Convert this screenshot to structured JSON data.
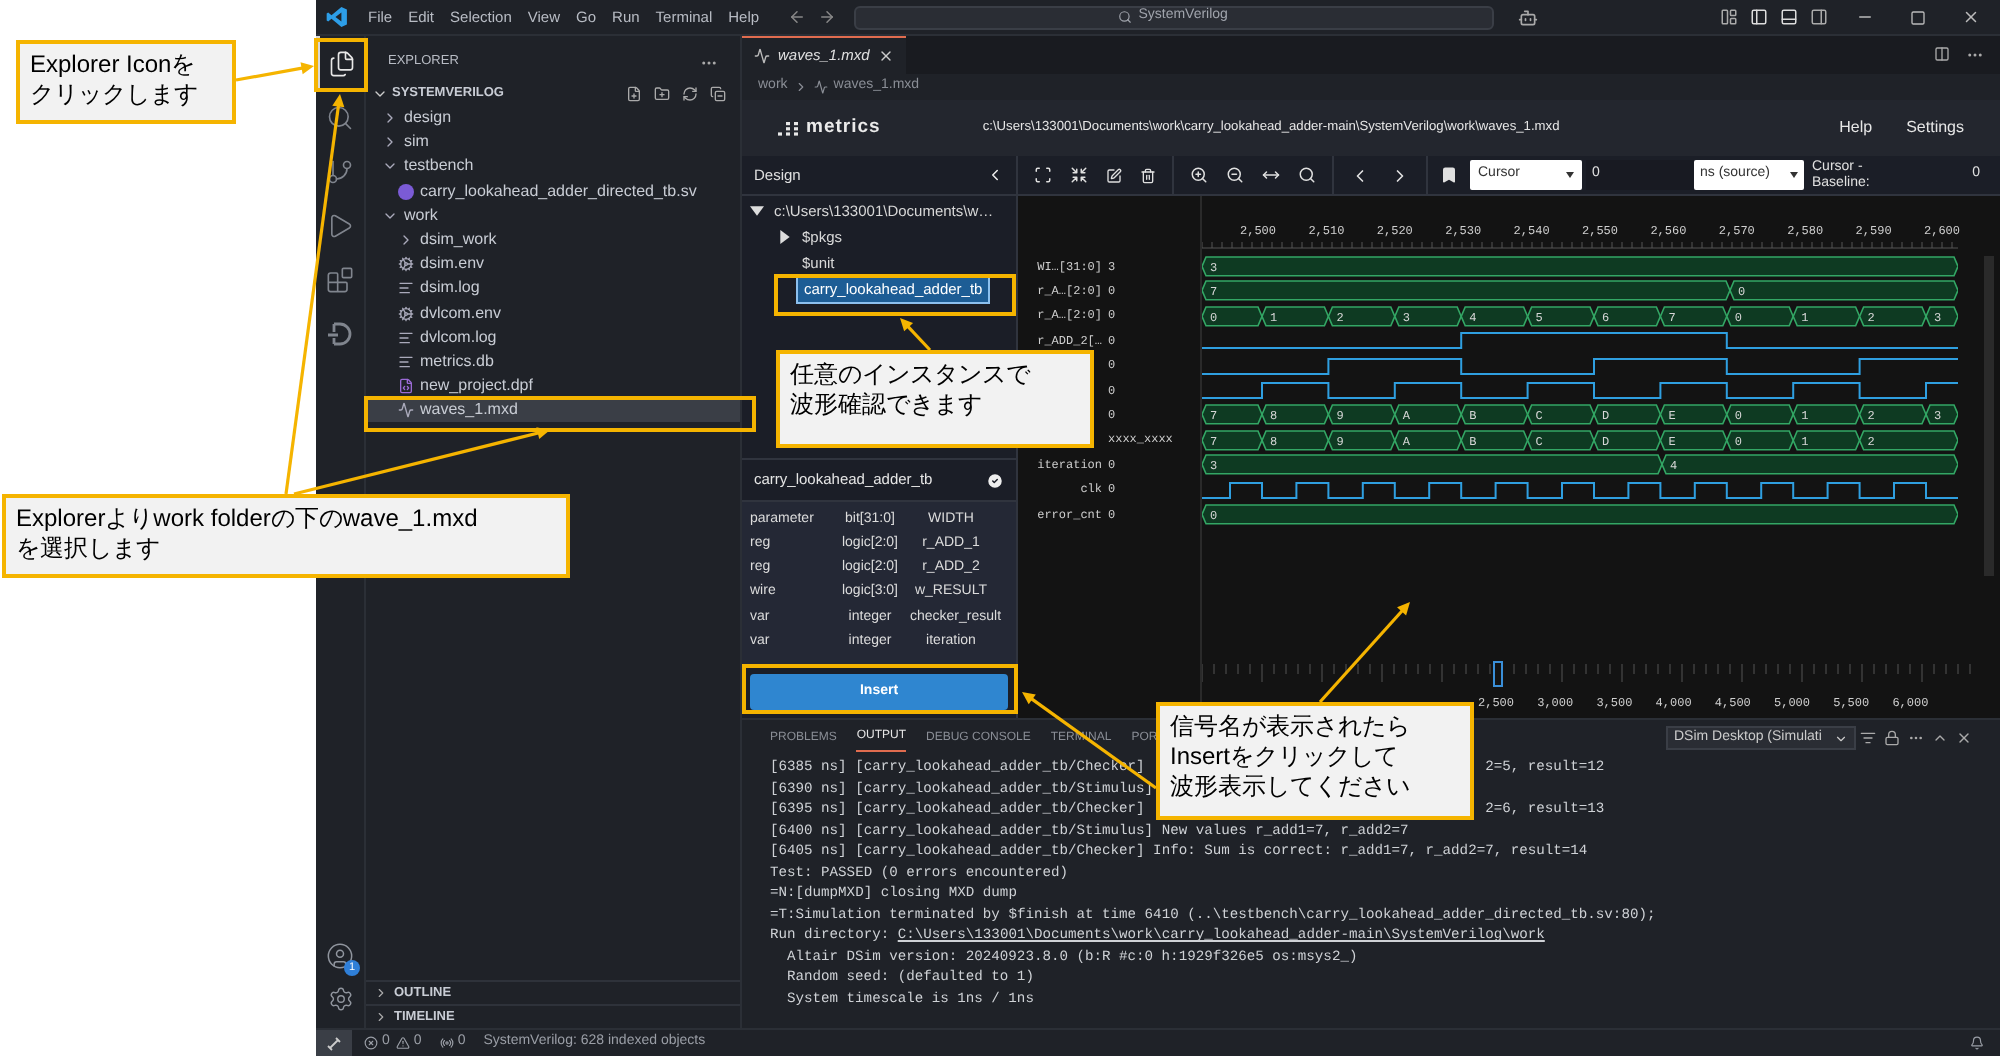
{
  "title_bar": {
    "menu": [
      "File",
      "Edit",
      "Selection",
      "View",
      "Go",
      "Run",
      "Terminal",
      "Help"
    ],
    "search": "SystemVerilog"
  },
  "activity_bar": {
    "items": [
      {
        "kind": "explorer",
        "selected": true
      },
      {
        "kind": "search",
        "selected": false
      },
      {
        "kind": "source-control",
        "selected": false
      },
      {
        "kind": "run",
        "selected": false
      },
      {
        "kind": "extensions",
        "selected": false
      },
      {
        "kind": "dsim",
        "selected": false
      }
    ],
    "account_badge": "1"
  },
  "sidebar": {
    "title": "EXPLORER",
    "section": "SYSTEMVERILOG",
    "tree": [
      {
        "label": "design",
        "kind": "folder",
        "expanded": false,
        "selected": false
      },
      {
        "label": "sim",
        "kind": "folder",
        "expanded": false,
        "selected": false
      },
      {
        "label": "testbench",
        "kind": "folder",
        "expanded": true,
        "selected": false,
        "children": [
          {
            "label": "carry_lookahead_adder_directed_tb.sv",
            "kind": "sv",
            "selected": false
          }
        ]
      },
      {
        "label": "work",
        "kind": "folder",
        "expanded": true,
        "selected": false,
        "children": [
          {
            "label": "dsim_work",
            "kind": "folder",
            "expanded": false,
            "selected": false
          },
          {
            "label": "dsim.env",
            "kind": "env",
            "selected": false
          },
          {
            "label": "dsim.log",
            "kind": "log",
            "selected": false
          },
          {
            "label": "dvlcom.env",
            "kind": "env",
            "selected": false
          },
          {
            "label": "dvlcom.log",
            "kind": "log",
            "selected": false
          },
          {
            "label": "metrics.db",
            "kind": "log",
            "selected": false
          },
          {
            "label": "new_project.dpf",
            "kind": "dpf",
            "selected": false
          },
          {
            "label": "waves_1.mxd",
            "kind": "wave",
            "selected": true
          }
        ]
      }
    ],
    "outline": "OUTLINE",
    "timeline": "TIMELINE"
  },
  "editor": {
    "tab": "waves_1.mxd",
    "breadcrumb": [
      "work",
      "waves_1.mxd"
    ]
  },
  "viewer": {
    "brand": "metrics",
    "path": "c:\\Users\\133001\\Documents\\work\\carry_lookahead_adder-main\\SystemVerilog\\work\\waves_1.mxd",
    "menu": [
      "Help",
      "Settings"
    ],
    "design": {
      "title": "Design",
      "tree": [
        {
          "label": "c:\\Users\\133001\\Documents\\w…",
          "expanded": true,
          "selected": false,
          "children": [
            {
              "label": "$pkgs",
              "expanded": false,
              "selected": false
            },
            {
              "label": "$unit",
              "selected": false
            },
            {
              "label": "carry_lookahead_adder_tb",
              "selected": true
            }
          ]
        }
      ]
    },
    "scope": {
      "title": "carry_lookahead_adder_tb",
      "variables": [
        {
          "type": "parameter",
          "datatype": "bit[31:0]",
          "name": "WIDTH"
        },
        {
          "type": "reg",
          "datatype": "logic[2:0]",
          "name": "r_ADD_1"
        },
        {
          "type": "reg",
          "datatype": "logic[2:0]",
          "name": "r_ADD_2"
        },
        {
          "type": "wire",
          "datatype": "logic[3:0]",
          "name": "w_RESULT"
        },
        {
          "type": "var",
          "datatype": "integer",
          "name": "checker_result"
        },
        {
          "type": "var",
          "datatype": "integer",
          "name": "iteration"
        }
      ],
      "insert": "Insert"
    },
    "toolbar": {
      "cursor": "Cursor",
      "cursor_value": "0",
      "unit": "ns (source)",
      "baseline_label": "Cursor - Baseline:",
      "baseline_value": "0"
    },
    "ruler": [
      "2,500",
      "2,510",
      "2,520",
      "2,530",
      "2,540",
      "2,550",
      "2,560",
      "2,570",
      "2,580",
      "2,590",
      "2,600"
    ],
    "signals": [
      {
        "name": "WI…[31:0]",
        "value": "3",
        "kind": "bus",
        "segments": [
          {
            "label": "3",
            "kind": "fill"
          }
        ]
      },
      {
        "name": "r_A…[2:0]",
        "value": "0",
        "kind": "bus",
        "segments": [
          {
            "label": "7",
            "kind": "fill"
          },
          {
            "label": "0",
            "kind": "end"
          }
        ]
      },
      {
        "name": "r_A…[2:0]",
        "value": "0",
        "kind": "bus",
        "segments": [
          {
            "label": "0",
            "kind": "unit"
          },
          {
            "label": "1",
            "kind": "unit"
          },
          {
            "label": "2",
            "kind": "unit"
          },
          {
            "label": "3",
            "kind": "unit"
          },
          {
            "label": "4",
            "kind": "unit"
          },
          {
            "label": "5",
            "kind": "unit"
          },
          {
            "label": "6",
            "kind": "unit"
          },
          {
            "label": "7",
            "kind": "unit"
          },
          {
            "label": "0",
            "kind": "unit"
          },
          {
            "label": "1",
            "kind": "unit"
          },
          {
            "label": "2",
            "kind": "unit"
          },
          {
            "label": "3",
            "kind": "fill"
          }
        ]
      },
      {
        "name": "r_ADD_2[…",
        "value": "0",
        "kind": "slow"
      },
      {
        "value": "0",
        "kind": "medium"
      },
      {
        "value": "0",
        "kind": "fast"
      },
      {
        "value": "0",
        "kind": "bus",
        "segments": [
          {
            "label": "7",
            "kind": "unit"
          },
          {
            "label": "8",
            "kind": "unit"
          },
          {
            "label": "9",
            "kind": "unit"
          },
          {
            "label": "A",
            "kind": "unit"
          },
          {
            "label": "B",
            "kind": "unit"
          },
          {
            "label": "C",
            "kind": "unit"
          },
          {
            "label": "D",
            "kind": "unit"
          },
          {
            "label": "E",
            "kind": "unit"
          },
          {
            "label": "0",
            "kind": "unit"
          },
          {
            "label": "1",
            "kind": "unit"
          },
          {
            "label": "2",
            "kind": "unit"
          },
          {
            "label": "3",
            "kind": "fill"
          }
        ]
      },
      {
        "value": "xxxx_xxxx",
        "kind": "bus",
        "segments": [
          {
            "label": "7",
            "kind": "unit"
          },
          {
            "label": "8",
            "kind": "unit"
          },
          {
            "label": "9",
            "kind": "unit"
          },
          {
            "label": "A",
            "kind": "unit"
          },
          {
            "label": "B",
            "kind": "unit"
          },
          {
            "label": "C",
            "kind": "unit"
          },
          {
            "label": "D",
            "kind": "unit"
          },
          {
            "label": "E",
            "kind": "unit"
          },
          {
            "label": "0",
            "kind": "unit"
          },
          {
            "label": "1",
            "kind": "unit"
          },
          {
            "label": "2",
            "kind": "fill"
          }
        ]
      },
      {
        "name": "iteration",
        "value": "0",
        "kind": "bus",
        "segments": [
          {
            "label": "3",
            "kind": "fill"
          },
          {
            "label": "4",
            "kind": "tail"
          }
        ]
      },
      {
        "name": "clk",
        "value": "0",
        "kind": "clock"
      },
      {
        "name": "error_cnt",
        "value": "0",
        "kind": "bus",
        "segments": [
          {
            "label": "0",
            "kind": "fill"
          }
        ]
      }
    ],
    "overview_ruler": [
      "2,500",
      "3,000",
      "3,500",
      "4,000",
      "4,500",
      "5,000",
      "5,500",
      "6,000"
    ]
  },
  "panel": {
    "tabs": [
      {
        "label": "PROBLEMS",
        "selected": false
      },
      {
        "label": "OUTPUT",
        "selected": true
      },
      {
        "label": "DEBUG CONSOLE",
        "selected": false
      },
      {
        "label": "TERMINAL",
        "selected": false
      },
      {
        "label": "POR",
        "selected": false
      }
    ],
    "channel": "DSim Desktop (Simulati",
    "lines": [
      {
        "kind": "plain",
        "text": "[6385 ns] [carry_lookahead_adder_tb/Checker]",
        "tail": "2=5, result=12"
      },
      {
        "kind": "plain",
        "text": "[6390 ns] [carry_lookahead_adder_tb/Stimulus]"
      },
      {
        "kind": "plain",
        "text": "[6395 ns] [carry_lookahead_adder_tb/Checker]",
        "tail": "2=6, result=13"
      },
      {
        "kind": "plain",
        "text": "[6400 ns] [carry_lookahead_adder_tb/Stimulus] New values r_add1=7, r_add2=7"
      },
      {
        "kind": "plain",
        "text": "[6405 ns] [carry_lookahead_adder_tb/Checker] Info: Sum is correct: r_add1=7, r_add2=7, result=14"
      },
      {
        "kind": "plain",
        "text": "Test: PASSED (0 errors encountered)"
      },
      {
        "kind": "plain",
        "text": "=N:[dumpMXD] closing MXD dump"
      },
      {
        "kind": "plain",
        "text": "=T:Simulation terminated by $finish at time 6410 (..\\testbench\\carry_lookahead_adder_directed_tb.sv:80);"
      },
      {
        "kind": "link",
        "text": "Run directory:",
        "link": "C:\\Users\\133001\\Documents\\work\\carry_lookahead_adder-main\\SystemVerilog\\work"
      },
      {
        "kind": "indent",
        "text": "Altair DSim version: 20240923.8.0 (b:R #c:0 h:1929f326e5 os:msys2_)"
      },
      {
        "kind": "indent",
        "text": "Random seed: (defaulted to 1)"
      },
      {
        "kind": "indent",
        "text": "System timescale is 1ns / 1ns"
      }
    ]
  },
  "status_bar": {
    "errors": "0",
    "warnings": "0",
    "ports": "0",
    "message": "SystemVerilog: 628 indexed objects"
  },
  "callouts": [
    {
      "lines": [
        "Explorer Iconを",
        "クリックします"
      ]
    },
    {
      "lines": [
        "Explorerよりwork folderの下のwave_1.mxd",
        "を選択します"
      ]
    },
    {
      "lines": [
        "任意のインスタンスで",
        "波形確認できます"
      ]
    },
    {
      "lines": [
        "信号名が表示されたら",
        "Insertをクリックして",
        "波形表示してください"
      ]
    }
  ]
}
